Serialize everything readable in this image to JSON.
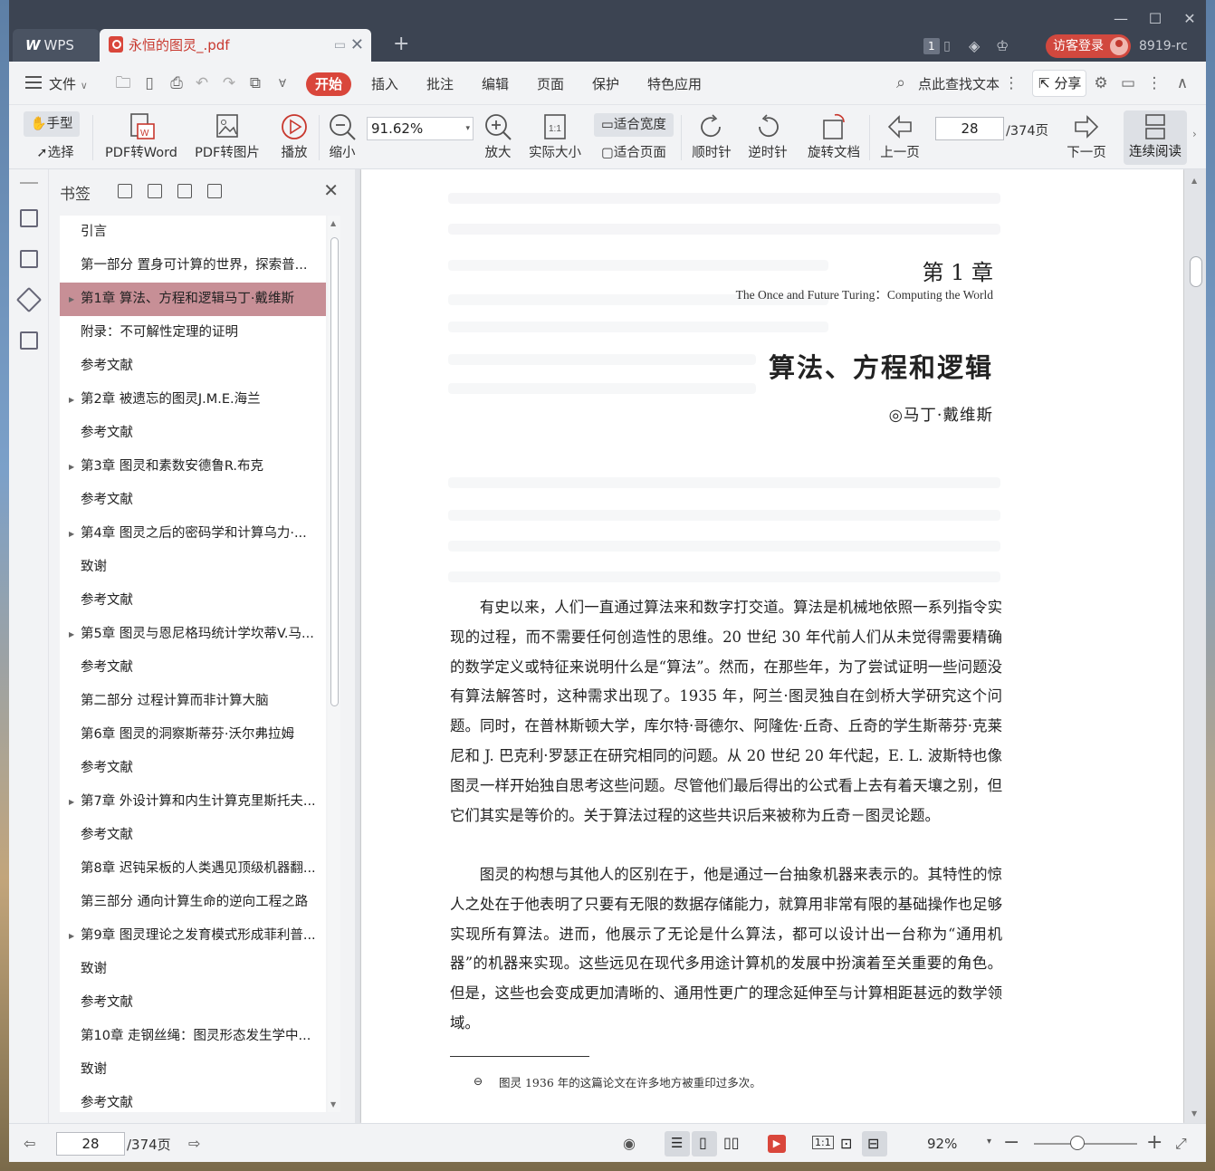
{
  "app": {
    "tab_wps": "WPS",
    "tab_doc_title": "永恒的图灵_.pdf",
    "page_badge": "1",
    "login_label": "访客登录",
    "user_code": "8919-rc"
  },
  "menu": {
    "file": "文件",
    "items": [
      "开始",
      "插入",
      "批注",
      "编辑",
      "页面",
      "保护",
      "特色应用"
    ],
    "search_label": "点此查找文本",
    "share_label": "分享"
  },
  "toolbar": {
    "hand": "手型",
    "select": "选择",
    "pdf_to_word": "PDF转Word",
    "pdf_to_image": "PDF转图片",
    "play": "播放",
    "zoom_out": "缩小",
    "zoom_value": "91.62%",
    "zoom_in": "放大",
    "actual_size": "实际大小",
    "fit_width": "适合宽度",
    "fit_page": "适合页面",
    "clockwise": "顺时针",
    "counterclockwise": "逆时针",
    "rotate_doc": "旋转文档",
    "prev_page": "上一页",
    "page_value": "28",
    "page_total": "/374页",
    "next_page": "下一页",
    "continuous": "连续阅读"
  },
  "bookmarks": {
    "title": "书签",
    "items": [
      {
        "label": "引言",
        "expandable": false,
        "selected": false
      },
      {
        "label": "第一部分 置身可计算的世界，探索普...",
        "expandable": false,
        "selected": false
      },
      {
        "label": "第1章 算法、方程和逻辑马丁·戴维斯",
        "expandable": true,
        "selected": true
      },
      {
        "label": "附录：不可解性定理的证明",
        "expandable": false,
        "selected": false
      },
      {
        "label": "参考文献",
        "expandable": false,
        "selected": false
      },
      {
        "label": "第2章 被遗忘的图灵J.M.E.海兰",
        "expandable": true,
        "selected": false
      },
      {
        "label": "参考文献",
        "expandable": false,
        "selected": false
      },
      {
        "label": "第3章 图灵和素数安德鲁R.布克",
        "expandable": true,
        "selected": false
      },
      {
        "label": "参考文献",
        "expandable": false,
        "selected": false
      },
      {
        "label": "第4章 图灵之后的密码学和计算乌力·...",
        "expandable": true,
        "selected": false
      },
      {
        "label": "致谢",
        "expandable": false,
        "selected": false
      },
      {
        "label": "参考文献",
        "expandable": false,
        "selected": false
      },
      {
        "label": "第5章 图灵与恩尼格玛统计学坎蒂V.马...",
        "expandable": true,
        "selected": false
      },
      {
        "label": "参考文献",
        "expandable": false,
        "selected": false
      },
      {
        "label": "第二部分 过程计算而非计算大脑",
        "expandable": false,
        "selected": false
      },
      {
        "label": "第6章 图灵的洞察斯蒂芬·沃尔弗拉姆",
        "expandable": false,
        "selected": false
      },
      {
        "label": "参考文献",
        "expandable": false,
        "selected": false
      },
      {
        "label": "第7章 外设计算和内生计算克里斯托夫...",
        "expandable": true,
        "selected": false
      },
      {
        "label": "参考文献",
        "expandable": false,
        "selected": false
      },
      {
        "label": "第8章 迟钝呆板的人类遇见顶级机器翻...",
        "expandable": false,
        "selected": false
      },
      {
        "label": "第三部分 通向计算生命的逆向工程之路",
        "expandable": false,
        "selected": false
      },
      {
        "label": "第9章 图灵理论之发育模式形成菲利普...",
        "expandable": true,
        "selected": false
      },
      {
        "label": "致谢",
        "expandable": false,
        "selected": false
      },
      {
        "label": "参考文献",
        "expandable": false,
        "selected": false
      },
      {
        "label": "第10章 走钢丝绳：图灵形态发生学中...",
        "expandable": false,
        "selected": false
      },
      {
        "label": "致谢",
        "expandable": false,
        "selected": false
      },
      {
        "label": "参考文献",
        "expandable": false,
        "selected": false
      }
    ]
  },
  "document": {
    "chapter_number": "第 1 章",
    "chapter_subtitle_en": "The Once and Future Turing：Computing the World",
    "chapter_title": "算法、方程和逻辑",
    "author": "◎马丁·戴维斯",
    "paragraph1": "有史以来，人们一直通过算法来和数字打交道。算法是机械地依照一系列指令实现的过程，而不需要任何创造性的思维。20 世纪 30 年代前人们从未觉得需要精确的数学定义或特征来说明什么是“算法”。然而，在那些年，为了尝试证明一些问题没有算法解答时，这种需求出现了。1935 年，阿兰·图灵独自在剑桥大学研究这个问题。同时，在普林斯顿大学，库尔特·哥德尔、阿隆佐·丘奇、丘奇的学生斯蒂芬·克莱尼和 J. 巴克利·罗瑟正在研究相同的问题。从 20 世纪 20 年代起，E. L. 波斯特也像图灵一样开始独自思考这些问题。尽管他们最后得出的公式看上去有着天壤之别，但它们其实是等价的。关于算法过程的这些共识后来被称为丘奇－图灵论题。",
    "paragraph2": "图灵的构想与其他人的区别在于，他是通过一台抽象机器来表示的。其特性的惊人之处在于他表明了只要有无限的数据存储能力，就算用非常有限的基础操作也足够实现所有算法。进而，他展示了无论是什么算法，都可以设计出一台称为“通用机器”的机器来实现。这些远见在现代多用途计算机的发展中扮演着至关重要的角色。但是，这些也会变成更加清晰的、通用性更广的理念延伸至与计算相距甚远的数学领域。",
    "footnote_mark": "⊖",
    "footnote": "图灵 1936 年的这篇论文在许多地方被重印过多次。"
  },
  "statusbar": {
    "page_value": "28",
    "page_total": "/374页",
    "zoom": "92%"
  },
  "colors": {
    "accent": "#d9463b",
    "selected_bookmark": "#c78f96",
    "titlebar": "#3c4452"
  }
}
